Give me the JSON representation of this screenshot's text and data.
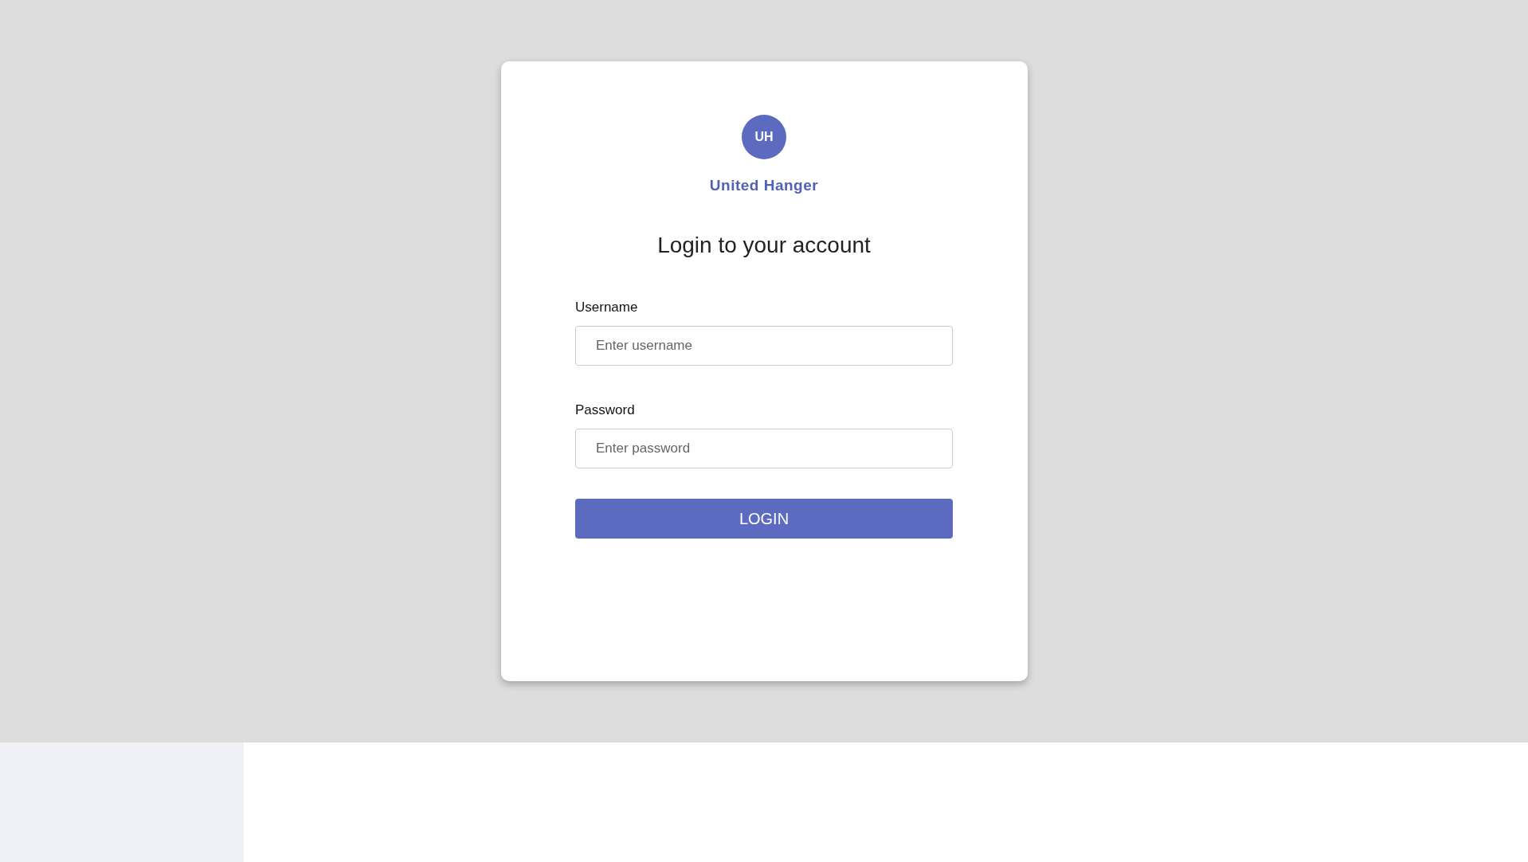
{
  "brand": {
    "initials": "UH",
    "name": "United Hanger"
  },
  "title": "Login to your account",
  "fields": [
    {
      "label": "Username",
      "placeholder": "Enter username"
    },
    {
      "label": "Password",
      "placeholder": "Enter password"
    }
  ],
  "button": "LOGIN"
}
